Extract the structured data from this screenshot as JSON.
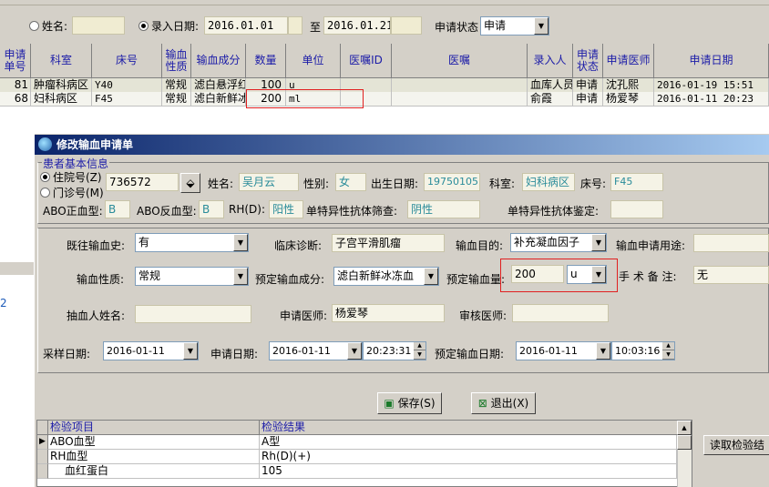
{
  "filter": {
    "name_radio_label": "姓名:",
    "entry_date_radio_label": "录入日期:",
    "date_from": "2016.01.01",
    "to_label": "至",
    "date_to": "2016.01.21",
    "status_label": "申请状态",
    "status_value": "申请"
  },
  "grid": {
    "columns": [
      "申请单号",
      "科室",
      "床号",
      "输血性质",
      "输血成分",
      "数量",
      "单位",
      "医嘱ID",
      "医嘱",
      "录入人",
      "申请状态",
      "申请医师",
      "申请日期"
    ],
    "rows": [
      {
        "id": "81",
        "dept": "肿瘤科病区",
        "bed": "Y40",
        "nature": "常规",
        "comp": "滤白悬浮红",
        "qty": "100",
        "unit": "u",
        "order_id": "",
        "order": "",
        "entry": "血库人员",
        "status": "申请",
        "doctor": "沈孔熙",
        "date": "2016-01-19 15:51"
      },
      {
        "id": "68",
        "dept": "妇科病区",
        "bed": "F45",
        "nature": "常规",
        "comp": "滤白新鲜冰",
        "qty": "200",
        "unit": "ml",
        "order_id": "",
        "order": "",
        "entry": "俞霞",
        "status": "申请",
        "doctor": "杨爱琴",
        "date": "2016-01-11 20:23"
      }
    ]
  },
  "left_fragment": "2",
  "dialog": {
    "title": "修改输血申请单",
    "group_title": "患者基本信息",
    "inpatient_label": "住院号(Z)",
    "outpatient_label": "门诊号(M)",
    "patient_no": "736572",
    "name_label": "姓名:",
    "name": "吴月云",
    "sex_label": "性别:",
    "sex": "女",
    "dob_label": "出生日期:",
    "dob": "19750105",
    "dept_label": "科室:",
    "dept": "妇科病区",
    "bed_label": "床号:",
    "bed": "F45",
    "abo_pos_label": "ABO正血型:",
    "abo_pos": "B",
    "abo_neg_label": "ABO反血型:",
    "abo_neg": "B",
    "rh_label": "RH(D):",
    "rh": "阳性",
    "antibody_screen_label": "单特异性抗体筛查:",
    "antibody_screen": "阴性",
    "antibody_id_label": "单特异性抗体鉴定:",
    "antibody_id": "",
    "history_label": "既往输血史:",
    "history": "有",
    "diagnosis_label": "临床诊断:",
    "diagnosis": "子宫平滑肌瘤",
    "purpose_label": "输血目的:",
    "purpose": "补充凝血因子",
    "use_label": "输血申请用途:",
    "use": "",
    "nature_label": "输血性质:",
    "nature": "常规",
    "component_label": "预定输血成分:",
    "component": "滤白新鲜冰冻血",
    "amount_label": "预定输血量:",
    "amount": "200",
    "amount_unit": "u",
    "surgery_note_label": "手 术 备 注:",
    "surgery_note": "无",
    "drawer_label": "抽血人姓名:",
    "drawer": "",
    "req_doctor_label": "申请医师:",
    "req_doctor": "杨爱琴",
    "reviewer_label": "审核医师:",
    "reviewer": "",
    "sample_date_label": "采样日期:",
    "sample_date": "2016-01-11",
    "apply_date_label": "申请日期:",
    "apply_date": "2016-01-11",
    "apply_time": "20:23:31",
    "planned_date_label": "预定输血日期:",
    "planned_date": "2016-01-11",
    "planned_time": "10:03:16",
    "save_label": "保存(S)",
    "exit_label": "退出(X)",
    "test_columns": [
      "检验项目",
      "检验结果"
    ],
    "tests": [
      {
        "item": "ABO血型",
        "result": "A型"
      },
      {
        "item": "RH血型",
        "result": "Rh(D)(+)"
      },
      {
        "item": "血红蛋白",
        "result": "105"
      }
    ],
    "read_results_label": "读取检验结"
  },
  "colors": {
    "highlight_box": "#e02020",
    "title_bar": "#0a246a",
    "header_text": "#1c1ca8",
    "field_text": "#2a8c9a"
  }
}
